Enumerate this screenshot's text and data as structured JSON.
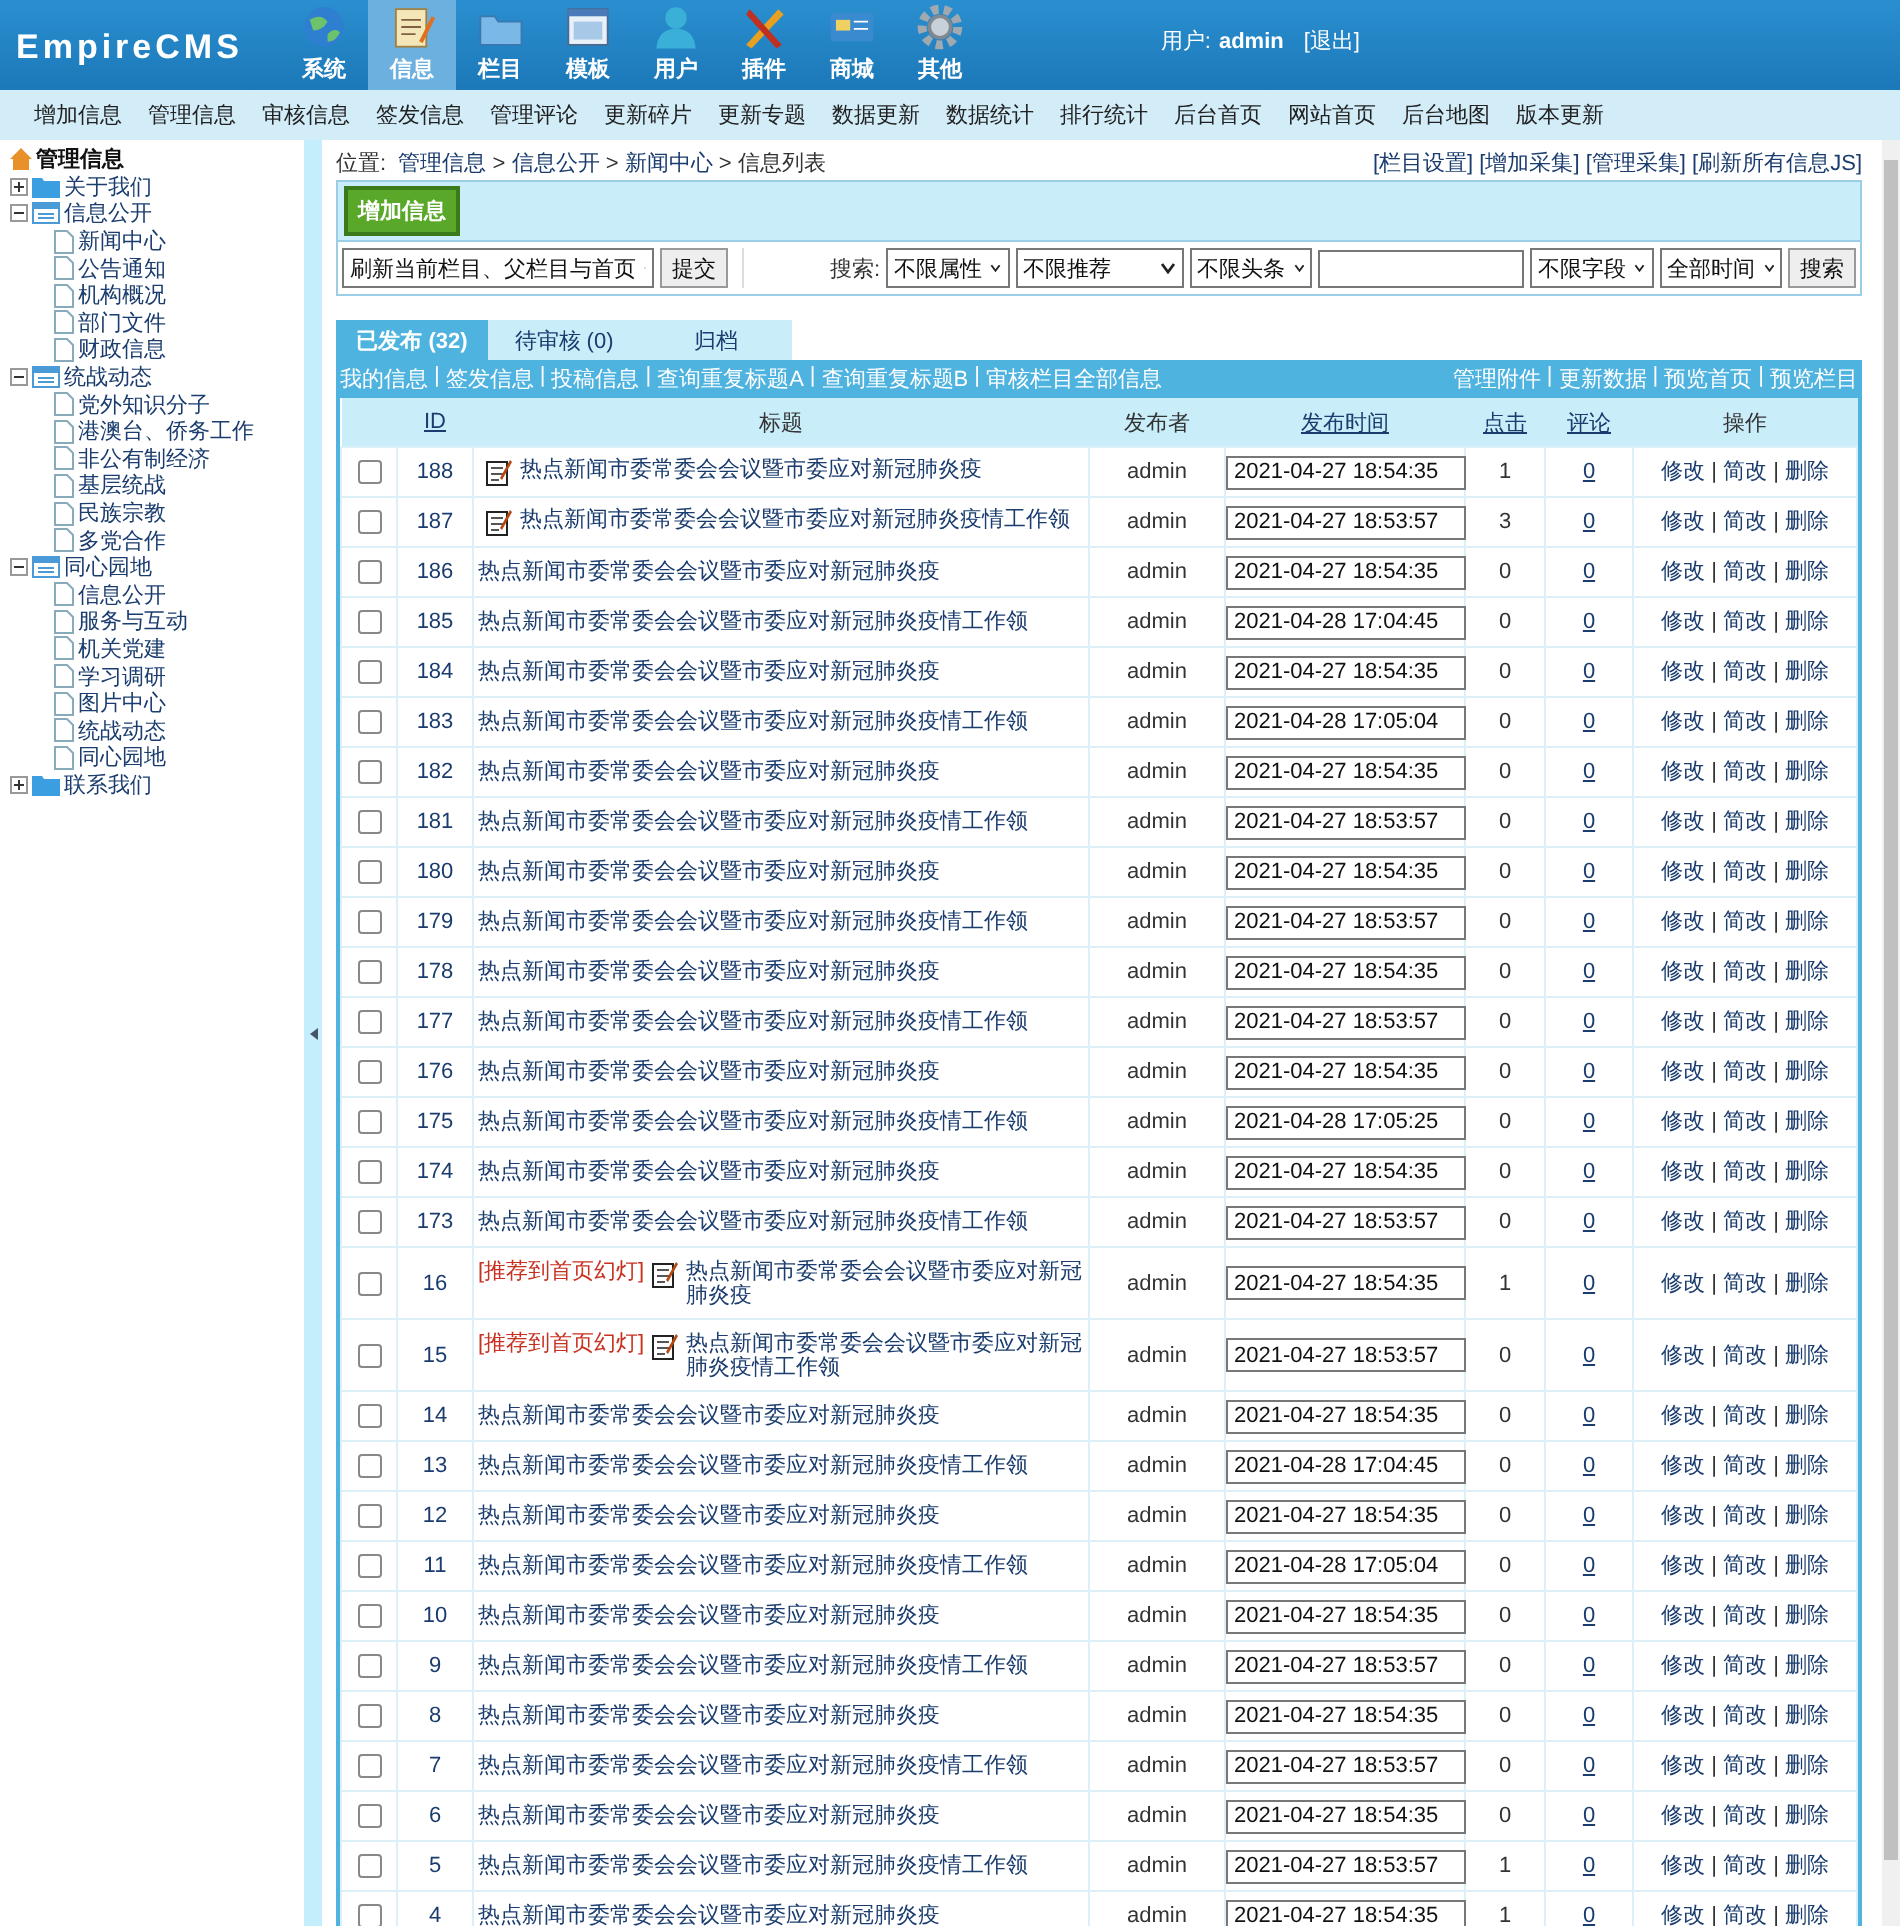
{
  "header": {
    "logo": "EmpireCMS",
    "nav": [
      {
        "label": "系统",
        "selected": false
      },
      {
        "label": "信息",
        "selected": true
      },
      {
        "label": "栏目",
        "selected": false
      },
      {
        "label": "模板",
        "selected": false
      },
      {
        "label": "用户",
        "selected": false
      },
      {
        "label": "插件",
        "selected": false
      },
      {
        "label": "商城",
        "selected": false
      },
      {
        "label": "其他",
        "selected": false
      }
    ],
    "user_label": "用户:",
    "user_name": "admin",
    "logout": "[退出]"
  },
  "menu": [
    "增加信息",
    "管理信息",
    "审核信息",
    "签发信息",
    "管理评论",
    "更新碎片",
    "更新专题",
    "数据更新",
    "数据统计",
    "排行统计",
    "后台首页",
    "网站首页",
    "后台地图",
    "版本更新"
  ],
  "sidebar": {
    "title": "管理信息",
    "items": [
      {
        "label": "关于我们",
        "expanded": false
      },
      {
        "label": "信息公开",
        "expanded": true,
        "children": [
          {
            "label": "新闻中心"
          },
          {
            "label": "公告通知"
          },
          {
            "label": "机构概况"
          },
          {
            "label": "部门文件"
          },
          {
            "label": "财政信息"
          }
        ]
      },
      {
        "label": "统战动态",
        "expanded": true,
        "children": [
          {
            "label": "党外知识分子"
          },
          {
            "label": "港澳台、侨务工作"
          },
          {
            "label": "非公有制经济"
          },
          {
            "label": "基层统战"
          },
          {
            "label": "民族宗教"
          },
          {
            "label": "多党合作"
          }
        ]
      },
      {
        "label": "同心园地",
        "expanded": true,
        "children": [
          {
            "label": "信息公开"
          },
          {
            "label": "服务与互动"
          },
          {
            "label": "机关党建"
          },
          {
            "label": "学习调研"
          },
          {
            "label": "图片中心"
          },
          {
            "label": "统战动态"
          },
          {
            "label": "同心园地"
          }
        ]
      },
      {
        "label": "联系我们",
        "expanded": false
      }
    ]
  },
  "location": {
    "label": "位置:",
    "crumbs": [
      "管理信息",
      "信息公开",
      "新闻中心",
      "信息列表"
    ],
    "separator": ">",
    "links": [
      "[栏目设置]",
      "[增加采集]",
      "[管理采集]",
      "[刷新所有信息JS]"
    ]
  },
  "toolbar": {
    "add_button": "增加信息",
    "refresh_select": "刷新当前栏目、父栏目与首页",
    "submit_button": "提交",
    "search_label": "搜索:",
    "selects": [
      "不限属性",
      "不限推荐",
      "不限头条"
    ],
    "field_select": "不限字段",
    "time_select": "全部时间",
    "search_button": "搜索"
  },
  "tabs": [
    {
      "label": "已发布 (32)",
      "selected": true
    },
    {
      "label": "待审核 (0)",
      "selected": false
    },
    {
      "label": "归档",
      "selected": false
    }
  ],
  "links_left": [
    "我的信息",
    "签发信息",
    "投稿信息",
    "查询重复标题A",
    "查询重复标题B",
    "审核栏目全部信息"
  ],
  "links_right": [
    "管理附件",
    "更新数据",
    "预览首页",
    "预览栏目"
  ],
  "link_separator": "|",
  "table": {
    "columns": [
      "ID",
      "标题",
      "发布者",
      "发布时间",
      "点击",
      "评论",
      "操作"
    ],
    "rows": [
      {
        "id": "188",
        "tag": "",
        "icon": true,
        "title": "热点新闻市委常委会会议暨市委应对新冠肺炎疫",
        "author": "admin",
        "time": "2021-04-27 18:54:35",
        "clicks": "1",
        "comments": "0",
        "checked": false,
        "actions": [
          "修改",
          "简改",
          "删除"
        ]
      },
      {
        "id": "187",
        "tag": "",
        "icon": true,
        "title": "热点新闻市委常委会会议暨市委应对新冠肺炎疫情工作领",
        "author": "admin",
        "time": "2021-04-27 18:53:57",
        "clicks": "3",
        "comments": "0",
        "checked": false,
        "actions": [
          "修改",
          "简改",
          "删除"
        ]
      },
      {
        "id": "186",
        "tag": "",
        "icon": false,
        "title": "热点新闻市委常委会会议暨市委应对新冠肺炎疫",
        "author": "admin",
        "time": "2021-04-27 18:54:35",
        "clicks": "0",
        "comments": "0",
        "checked": false,
        "actions": [
          "修改",
          "简改",
          "删除"
        ]
      },
      {
        "id": "185",
        "tag": "",
        "icon": false,
        "title": "热点新闻市委常委会会议暨市委应对新冠肺炎疫情工作领",
        "author": "admin",
        "time": "2021-04-28 17:04:45",
        "clicks": "0",
        "comments": "0",
        "checked": false,
        "actions": [
          "修改",
          "简改",
          "删除"
        ]
      },
      {
        "id": "184",
        "tag": "",
        "icon": false,
        "title": "热点新闻市委常委会会议暨市委应对新冠肺炎疫",
        "author": "admin",
        "time": "2021-04-27 18:54:35",
        "clicks": "0",
        "comments": "0",
        "checked": false,
        "actions": [
          "修改",
          "简改",
          "删除"
        ]
      },
      {
        "id": "183",
        "tag": "",
        "icon": false,
        "title": "热点新闻市委常委会会议暨市委应对新冠肺炎疫情工作领",
        "author": "admin",
        "time": "2021-04-28 17:05:04",
        "clicks": "0",
        "comments": "0",
        "checked": false,
        "actions": [
          "修改",
          "简改",
          "删除"
        ]
      },
      {
        "id": "182",
        "tag": "",
        "icon": false,
        "title": "热点新闻市委常委会会议暨市委应对新冠肺炎疫",
        "author": "admin",
        "time": "2021-04-27 18:54:35",
        "clicks": "0",
        "comments": "0",
        "checked": false,
        "actions": [
          "修改",
          "简改",
          "删除"
        ]
      },
      {
        "id": "181",
        "tag": "",
        "icon": false,
        "title": "热点新闻市委常委会会议暨市委应对新冠肺炎疫情工作领",
        "author": "admin",
        "time": "2021-04-27 18:53:57",
        "clicks": "0",
        "comments": "0",
        "checked": false,
        "actions": [
          "修改",
          "简改",
          "删除"
        ]
      },
      {
        "id": "180",
        "tag": "",
        "icon": false,
        "title": "热点新闻市委常委会会议暨市委应对新冠肺炎疫",
        "author": "admin",
        "time": "2021-04-27 18:54:35",
        "clicks": "0",
        "comments": "0",
        "checked": false,
        "actions": [
          "修改",
          "简改",
          "删除"
        ]
      },
      {
        "id": "179",
        "tag": "",
        "icon": false,
        "title": "热点新闻市委常委会会议暨市委应对新冠肺炎疫情工作领",
        "author": "admin",
        "time": "2021-04-27 18:53:57",
        "clicks": "0",
        "comments": "0",
        "checked": false,
        "actions": [
          "修改",
          "简改",
          "删除"
        ]
      },
      {
        "id": "178",
        "tag": "",
        "icon": false,
        "title": "热点新闻市委常委会会议暨市委应对新冠肺炎疫",
        "author": "admin",
        "time": "2021-04-27 18:54:35",
        "clicks": "0",
        "comments": "0",
        "checked": false,
        "actions": [
          "修改",
          "简改",
          "删除"
        ]
      },
      {
        "id": "177",
        "tag": "",
        "icon": false,
        "title": "热点新闻市委常委会会议暨市委应对新冠肺炎疫情工作领",
        "author": "admin",
        "time": "2021-04-27 18:53:57",
        "clicks": "0",
        "comments": "0",
        "checked": false,
        "actions": [
          "修改",
          "简改",
          "删除"
        ]
      },
      {
        "id": "176",
        "tag": "",
        "icon": false,
        "title": "热点新闻市委常委会会议暨市委应对新冠肺炎疫",
        "author": "admin",
        "time": "2021-04-27 18:54:35",
        "clicks": "0",
        "comments": "0",
        "checked": false,
        "actions": [
          "修改",
          "简改",
          "删除"
        ]
      },
      {
        "id": "175",
        "tag": "",
        "icon": false,
        "title": "热点新闻市委常委会会议暨市委应对新冠肺炎疫情工作领",
        "author": "admin",
        "time": "2021-04-28 17:05:25",
        "clicks": "0",
        "comments": "0",
        "checked": false,
        "actions": [
          "修改",
          "简改",
          "删除"
        ]
      },
      {
        "id": "174",
        "tag": "",
        "icon": false,
        "title": "热点新闻市委常委会会议暨市委应对新冠肺炎疫",
        "author": "admin",
        "time": "2021-04-27 18:54:35",
        "clicks": "0",
        "comments": "0",
        "checked": false,
        "actions": [
          "修改",
          "简改",
          "删除"
        ]
      },
      {
        "id": "173",
        "tag": "",
        "icon": false,
        "title": "热点新闻市委常委会会议暨市委应对新冠肺炎疫情工作领",
        "author": "admin",
        "time": "2021-04-27 18:53:57",
        "clicks": "0",
        "comments": "0",
        "checked": false,
        "actions": [
          "修改",
          "简改",
          "删除"
        ]
      },
      {
        "id": "16",
        "tag": "[推荐到首页幻灯]",
        "icon": true,
        "title": "热点新闻市委常委会会议暨市委应对新冠肺炎疫",
        "author": "admin",
        "time": "2021-04-27 18:54:35",
        "clicks": "1",
        "comments": "0",
        "checked": false,
        "actions": [
          "修改",
          "简改",
          "删除"
        ]
      },
      {
        "id": "15",
        "tag": "[推荐到首页幻灯]",
        "icon": true,
        "title": "热点新闻市委常委会会议暨市委应对新冠肺炎疫情工作领",
        "author": "admin",
        "time": "2021-04-27 18:53:57",
        "clicks": "0",
        "comments": "0",
        "checked": false,
        "actions": [
          "修改",
          "简改",
          "删除"
        ]
      },
      {
        "id": "14",
        "tag": "",
        "icon": false,
        "title": "热点新闻市委常委会会议暨市委应对新冠肺炎疫",
        "author": "admin",
        "time": "2021-04-27 18:54:35",
        "clicks": "0",
        "comments": "0",
        "checked": false,
        "actions": [
          "修改",
          "简改",
          "删除"
        ]
      },
      {
        "id": "13",
        "tag": "",
        "icon": false,
        "title": "热点新闻市委常委会会议暨市委应对新冠肺炎疫情工作领",
        "author": "admin",
        "time": "2021-04-28 17:04:45",
        "clicks": "0",
        "comments": "0",
        "checked": false,
        "actions": [
          "修改",
          "简改",
          "删除"
        ]
      },
      {
        "id": "12",
        "tag": "",
        "icon": false,
        "title": "热点新闻市委常委会会议暨市委应对新冠肺炎疫",
        "author": "admin",
        "time": "2021-04-27 18:54:35",
        "clicks": "0",
        "comments": "0",
        "checked": false,
        "actions": [
          "修改",
          "简改",
          "删除"
        ]
      },
      {
        "id": "11",
        "tag": "",
        "icon": false,
        "title": "热点新闻市委常委会会议暨市委应对新冠肺炎疫情工作领",
        "author": "admin",
        "time": "2021-04-28 17:05:04",
        "clicks": "0",
        "comments": "0",
        "checked": false,
        "actions": [
          "修改",
          "简改",
          "删除"
        ]
      },
      {
        "id": "10",
        "tag": "",
        "icon": false,
        "title": "热点新闻市委常委会会议暨市委应对新冠肺炎疫",
        "author": "admin",
        "time": "2021-04-27 18:54:35",
        "clicks": "0",
        "comments": "0",
        "checked": false,
        "actions": [
          "修改",
          "简改",
          "删除"
        ]
      },
      {
        "id": "9",
        "tag": "",
        "icon": false,
        "title": "热点新闻市委常委会会议暨市委应对新冠肺炎疫情工作领",
        "author": "admin",
        "time": "2021-04-27 18:53:57",
        "clicks": "0",
        "comments": "0",
        "checked": false,
        "actions": [
          "修改",
          "简改",
          "删除"
        ]
      },
      {
        "id": "8",
        "tag": "",
        "icon": false,
        "title": "热点新闻市委常委会会议暨市委应对新冠肺炎疫",
        "author": "admin",
        "time": "2021-04-27 18:54:35",
        "clicks": "0",
        "comments": "0",
        "checked": false,
        "actions": [
          "修改",
          "简改",
          "删除"
        ]
      },
      {
        "id": "7",
        "tag": "",
        "icon": false,
        "title": "热点新闻市委常委会会议暨市委应对新冠肺炎疫情工作领",
        "author": "admin",
        "time": "2021-04-27 18:53:57",
        "clicks": "0",
        "comments": "0",
        "checked": false,
        "actions": [
          "修改",
          "简改",
          "删除"
        ]
      },
      {
        "id": "6",
        "tag": "",
        "icon": false,
        "title": "热点新闻市委常委会会议暨市委应对新冠肺炎疫",
        "author": "admin",
        "time": "2021-04-27 18:54:35",
        "clicks": "0",
        "comments": "0",
        "checked": false,
        "actions": [
          "修改",
          "简改",
          "删除"
        ]
      },
      {
        "id": "5",
        "tag": "",
        "icon": false,
        "title": "热点新闻市委常委会会议暨市委应对新冠肺炎疫情工作领",
        "author": "admin",
        "time": "2021-04-27 18:53:57",
        "clicks": "1",
        "comments": "0",
        "checked": false,
        "actions": [
          "修改",
          "简改",
          "删除"
        ]
      },
      {
        "id": "4",
        "tag": "",
        "icon": false,
        "title": "热点新闻市委常委会会议暨市委应对新冠肺炎疫",
        "author": "admin",
        "time": "2021-04-27 18:54:35",
        "clicks": "1",
        "comments": "0",
        "checked": false,
        "actions": [
          "修改",
          "简改",
          "删除"
        ]
      }
    ]
  }
}
